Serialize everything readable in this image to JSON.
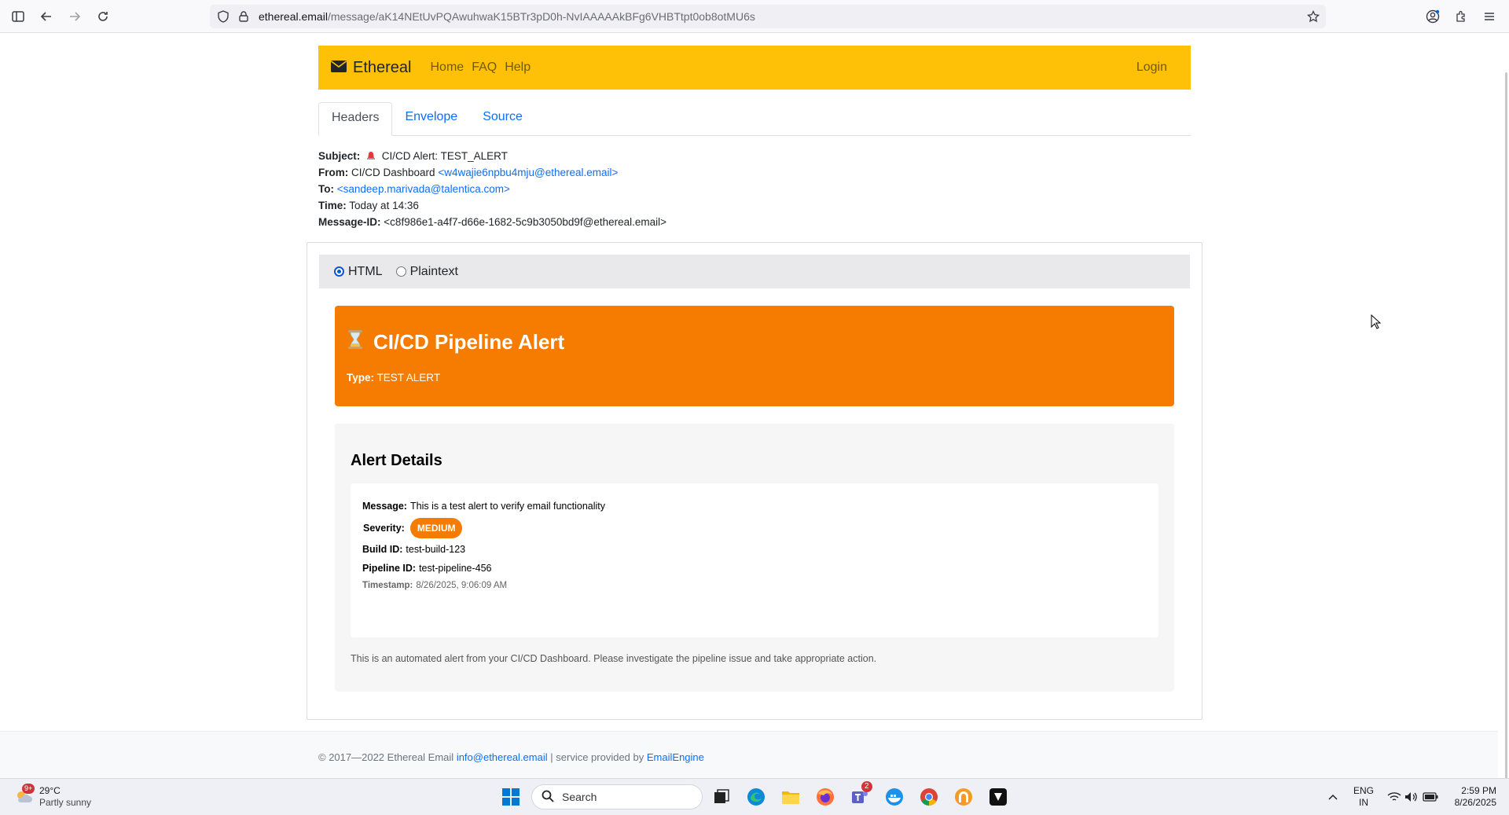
{
  "browser": {
    "url_host": "ethereal.email",
    "url_path": "/message/aK14NEtUvPQAwuhwaK15BTr3pD0h-NvIAAAAAkBFg6VHBTtpt0ob8otMU6s"
  },
  "navbar": {
    "brand": "Ethereal",
    "links": [
      "Home",
      "FAQ",
      "Help"
    ],
    "login": "Login",
    "color": "#ffc107"
  },
  "tabs": [
    {
      "label": "Headers",
      "active": true
    },
    {
      "label": "Envelope",
      "active": false
    },
    {
      "label": "Source",
      "active": false
    }
  ],
  "headers": {
    "subject_label": "Subject:",
    "subject_value": "CI/CD Alert: TEST_ALERT",
    "from_label": "From:",
    "from_name": "CI/CD Dashboard",
    "from_email": "<w4wajie6npbu4mju@ethereal.email>",
    "to_label": "To:",
    "to_email": "<sandeep.marivada@talentica.com>",
    "time_label": "Time:",
    "time_value": "Today at 14:36",
    "msgid_label": "Message-ID:",
    "msgid_value": "<c8f986e1-a4f7-d66e-1682-5c9b3050bd9f@ethereal.email>"
  },
  "format": {
    "html_label": "HTML",
    "plaintext_label": "Plaintext",
    "selected": "HTML"
  },
  "alert": {
    "title": "CI/CD Pipeline Alert",
    "type_label": "Type:",
    "type_value": "TEST ALERT",
    "color": "#f57c00"
  },
  "details": {
    "title": "Alert Details",
    "message_label": "Message:",
    "message_value": "This is a test alert to verify email functionality",
    "severity_label": "Severity:",
    "severity_value": "MEDIUM",
    "build_label": "Build ID:",
    "build_value": "test-build-123",
    "pipeline_label": "Pipeline ID:",
    "pipeline_value": "test-pipeline-456",
    "timestamp_label": "Timestamp:",
    "timestamp_value": "8/26/2025, 9:06:09 AM",
    "footer_note": "This is an automated alert from your CI/CD Dashboard. Please investigate the pipeline issue and take appropriate action."
  },
  "footer": {
    "copyright": "© 2017—2022 Ethereal Email",
    "email_link": "info@ethereal.email",
    "separator": "| service provided by",
    "provider_link": "EmailEngine"
  },
  "taskbar": {
    "weather_badge": "9+",
    "temperature": "29°C",
    "condition": "Partly sunny",
    "search_placeholder": "Search",
    "teams_badge": "2",
    "lang_line1": "ENG",
    "lang_line2": "IN",
    "time": "2:59 PM",
    "date": "8/26/2025"
  }
}
